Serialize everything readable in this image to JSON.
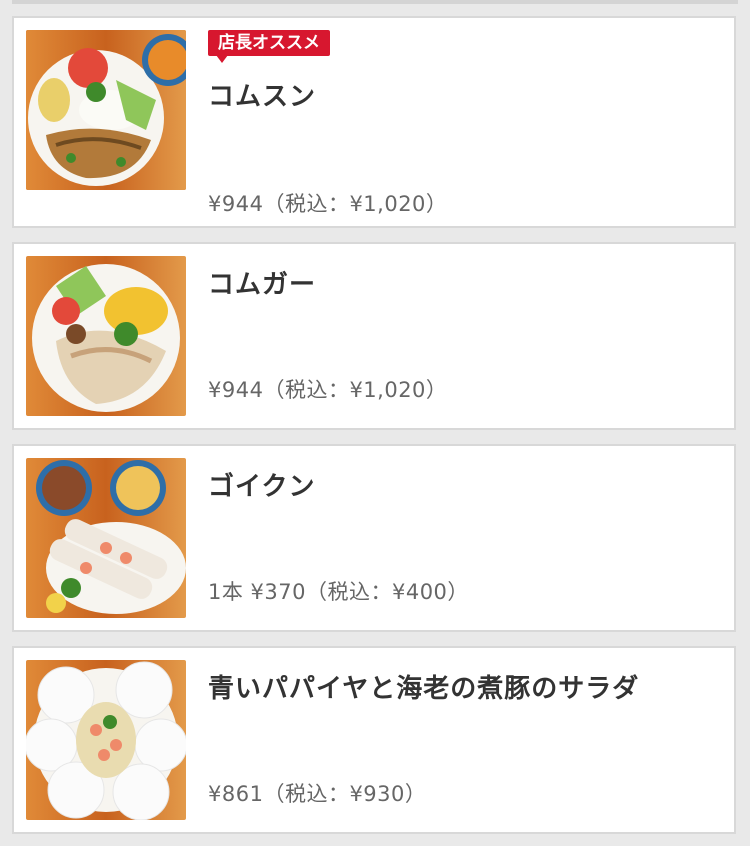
{
  "menu_items": [
    {
      "badge": "店長オススメ",
      "name": "コムスン",
      "price": "¥944（税込：¥1,020）",
      "image_icon": "com-suon-dish-photo"
    },
    {
      "name": "コムガー",
      "price": "¥944（税込：¥1,020）",
      "image_icon": "com-ga-dish-photo"
    },
    {
      "name": "ゴイクン",
      "price": "1本 ¥370（税込：¥400）",
      "image_icon": "goi-cuon-dish-photo"
    },
    {
      "name": "青いパパイヤと海老の煮豚のサラダ",
      "price": "¥861（税込：¥930）",
      "image_icon": "papaya-salad-dish-photo"
    }
  ],
  "colors": {
    "badge_red": "#d7172f",
    "title_text": "#333333",
    "price_text": "#666666",
    "background": "#e9e9e9",
    "card_border": "#d8d8d8"
  }
}
